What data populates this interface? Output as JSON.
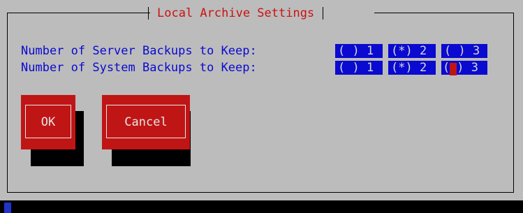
{
  "dialog": {
    "title": "Local Archive Settings"
  },
  "settings": {
    "server_backups": {
      "label": "Number of Server Backups to Keep:",
      "options": [
        "( ) 1",
        "(*) 2",
        "( ) 3"
      ],
      "selected": "2"
    },
    "system_backups": {
      "label": "Number of System Backups to Keep:",
      "options": [
        "( ) 1",
        "(*) 2",
        "( ) 3"
      ],
      "focused_option_suffix": ") 3",
      "selected": "2"
    }
  },
  "buttons": {
    "ok_label": "OK",
    "cancel_label": "Cancel"
  },
  "colors": {
    "background": "#bcbcbc",
    "option_background": "#0a0ad0",
    "button_background": "#c01515",
    "title_color": "#cc1111"
  }
}
